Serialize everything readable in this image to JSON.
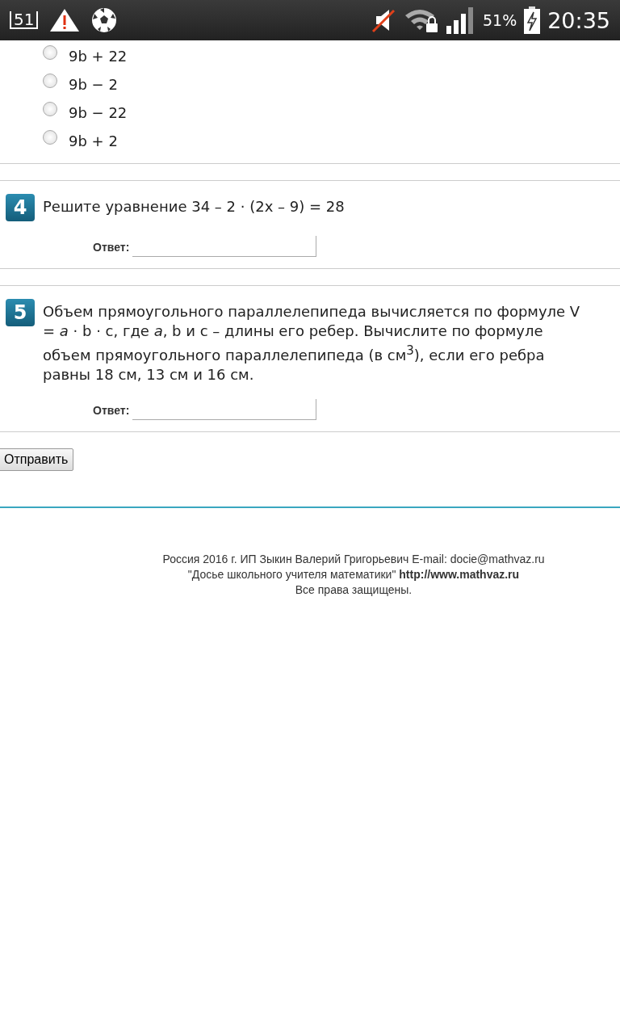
{
  "status_bar": {
    "notification_count": "51",
    "battery": "51%",
    "time": "20:35"
  },
  "questions": [
    {
      "kind": "choice",
      "options": [
        {
          "label": "9b + 22",
          "selected": false
        },
        {
          "label": "9b − 2",
          "selected": false
        },
        {
          "label": "9b − 22",
          "selected": false
        },
        {
          "label": "9b + 2",
          "selected": false
        }
      ]
    },
    {
      "kind": "answer",
      "number": "4",
      "text": "Решите уравнение   34 – 2 · (2x – 9) = 28",
      "answer_label": "Ответ:"
    },
    {
      "kind": "answer",
      "number": "5",
      "text": "Объем прямоугольного параллелепипеда вычисляется по формуле V = *a* · b · c, где  *a*, b и c – длины его ребер. Вычислите по формуле объем прямоугольного параллелепипеда (в см$^{3}$), если его ребра равны 18 см, 13 см и 16 см.",
      "answer_label": "Ответ:"
    }
  ],
  "submit_button": "Отправить",
  "footer": [
    {
      "text": "Россия 2016 г. ИП Зыкин Валерий Григорьевич E-mail: docie@mathvaz.ru"
    },
    {
      "text": "\"Досье школьного учителя математики\"",
      "link": "http://www.mathvaz.ru"
    },
    {
      "text": "Все права защищены."
    }
  ]
}
